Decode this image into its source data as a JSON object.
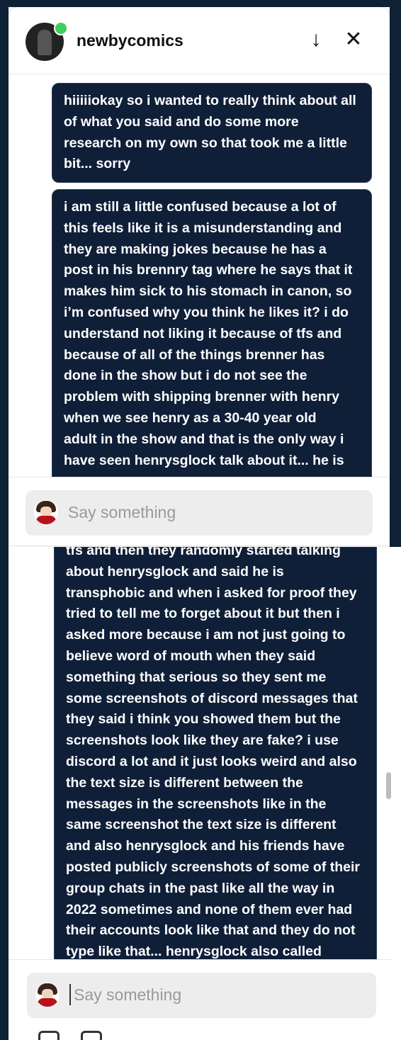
{
  "conversation": {
    "username": "newbycomics",
    "online": true,
    "icons": [
      "scroll-down-arrow-icon",
      "close-icon"
    ],
    "glyphs": {
      "scroll_down": "↓",
      "close": "✕"
    }
  },
  "messages_top": [
    {
      "lines": [
        "hiiiiiokay so i wanted to really think about all",
        "of what you said and do some more",
        "research on my own so that took me a little",
        "bit... sorry"
      ]
    },
    {
      "lines": [
        "i am still a little confused because a lot of",
        "this feels like it is a misunderstanding and",
        "they are making jokes because he has a",
        "post in his brennry tag where he says that it",
        "makes him sick to his stomach in canon, so",
        "i’m confused why you think he likes it? i do",
        "understand not liking it because of tfs and",
        "because of all of the things brenner has",
        "done in the show but i do not see the",
        "problem with shipping brenner with henry",
        "when we see henry as a 30-40 year old",
        "adult in the show and that is the only way i",
        "have seen henrysglock talk about it... he is"
      ]
    }
  ],
  "messages_bottom": [
    {
      "lines": [
        "tfs and then they randomly started talking",
        "about henrysglock and said he is",
        "transphobic and when i asked for proof they",
        "tried to tell me to forget about it but then i",
        "asked more because i am not just going to",
        "believe word of mouth when they said",
        "something that serious so they sent me",
        "some screenshots of discord messages that",
        "they said i think you showed them but the",
        "screenshots look like they are fake? i use",
        "discord a lot and it just looks weird and also",
        "the text size is different between the",
        "messages in the screenshots like in the",
        "same screenshot the text size is different",
        "and also henrysglock and his friends have",
        "posted publicly screenshots of some of their",
        "group chats in the past like all the way in",
        "2022 sometimes and none of them ever had",
        "their accounts look like that and they do not",
        "type like that... henrysglock also called"
      ]
    }
  ],
  "composer": {
    "placeholder": "Say something"
  },
  "colors": {
    "bubble_bg": "#0f1f38",
    "bubble_text": "#ffffff",
    "online": "#3ecf5a",
    "input_bg": "#ededed",
    "placeholder": "#9a9a9a"
  }
}
